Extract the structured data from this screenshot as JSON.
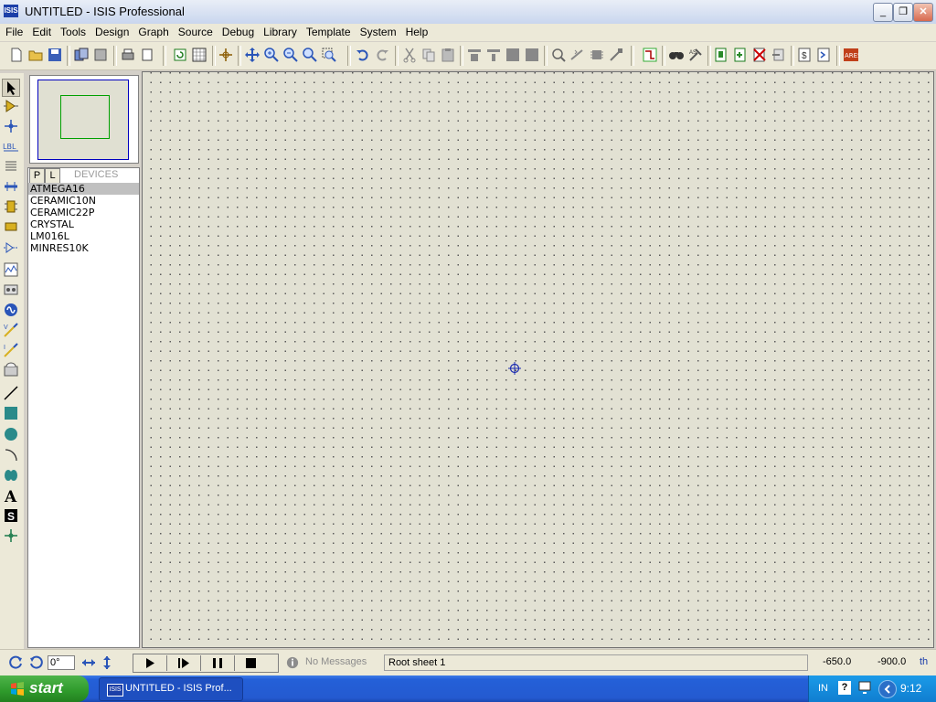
{
  "window": {
    "title": "UNTITLED - ISIS Professional",
    "app_icon": "ISIS"
  },
  "menu": [
    "File",
    "Edit",
    "Tools",
    "Design",
    "Graph",
    "Source",
    "Debug",
    "Library",
    "Template",
    "System",
    "Help"
  ],
  "devices": {
    "tab_p": "P",
    "tab_l": "L",
    "label": "DEVICES",
    "items": [
      "ATMEGA16",
      "CERAMIC10N",
      "CERAMIC22P",
      "CRYSTAL",
      "LM016L",
      "MINRES10K"
    ],
    "selected": "ATMEGA16"
  },
  "left_tools": {
    "label_tool": "LBL"
  },
  "status": {
    "rotation": "0°",
    "messages": "No Messages",
    "sheet": "Root sheet 1",
    "coord_x": "-650.0",
    "coord_y": "-900.0",
    "unit": "th"
  },
  "taskbar": {
    "start_label": "start",
    "task_label": "UNTITLED - ISIS Prof...",
    "lang": "IN",
    "help": "?",
    "clock": "9:12"
  },
  "colors": {
    "canvas_bg": "#e2e1d3",
    "overview_sheet_border": "#00a000",
    "overview_frame": "#0000c0",
    "taskbar_blue": "#245ad0",
    "start_green": "#2e9a2b"
  }
}
